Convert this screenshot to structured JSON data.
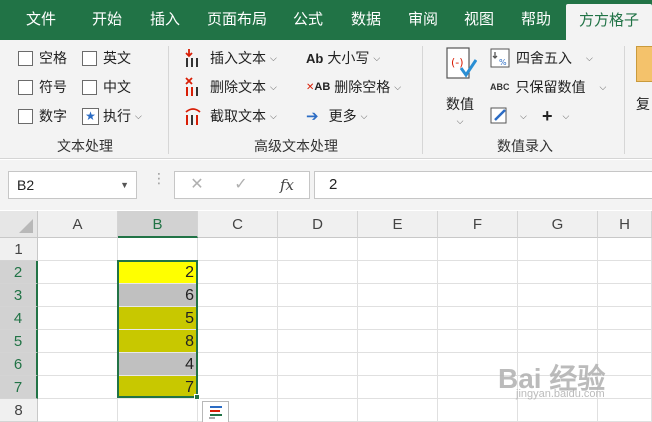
{
  "tabs": [
    "文件",
    "开始",
    "插入",
    "页面布局",
    "公式",
    "数据",
    "审阅",
    "视图",
    "帮助",
    "方方格子"
  ],
  "active_tab": "方方格子",
  "ribbon": {
    "text_processing": {
      "checkboxes": [
        "空格",
        "英文",
        "符号",
        "中文",
        "数字"
      ],
      "execute_label": "执行",
      "group_label": "文本处理"
    },
    "advanced_text": {
      "insert_text": "插入文本",
      "delete_text": "删除文本",
      "extract_text": "截取文本",
      "case_label": "大小写",
      "delete_spaces": "删除空格",
      "more": "更多",
      "group_label": "高级文本处理",
      "ab_icon": "Ab",
      "ab_icon2": "AB"
    },
    "value_entry": {
      "value_button": "数值",
      "round_label": "四舍五入",
      "keep_values": "只保留数值",
      "abc_icon": "ABC",
      "group_label": "数值录入",
      "cutoff_label": "复"
    }
  },
  "formula_bar": {
    "name_box": "B2",
    "cancel_icon": "✕",
    "confirm_icon": "✓",
    "fx_icon": "fx",
    "formula": "2"
  },
  "grid": {
    "columns": [
      "A",
      "B",
      "C",
      "D",
      "E",
      "F",
      "G",
      "H"
    ],
    "rows": [
      "1",
      "2",
      "3",
      "4",
      "5",
      "6",
      "7",
      "8"
    ],
    "selected_column": "B",
    "b_values": [
      "2",
      "6",
      "5",
      "8",
      "4",
      "7"
    ],
    "cell_colors": [
      "#ffff00",
      "#c0c0c0",
      "#c8c800",
      "#c8c800",
      "#c0c0c0",
      "#c8c800"
    ]
  },
  "watermark": {
    "text": "Bai 经验",
    "sub": "jingyan.baidu.com"
  }
}
